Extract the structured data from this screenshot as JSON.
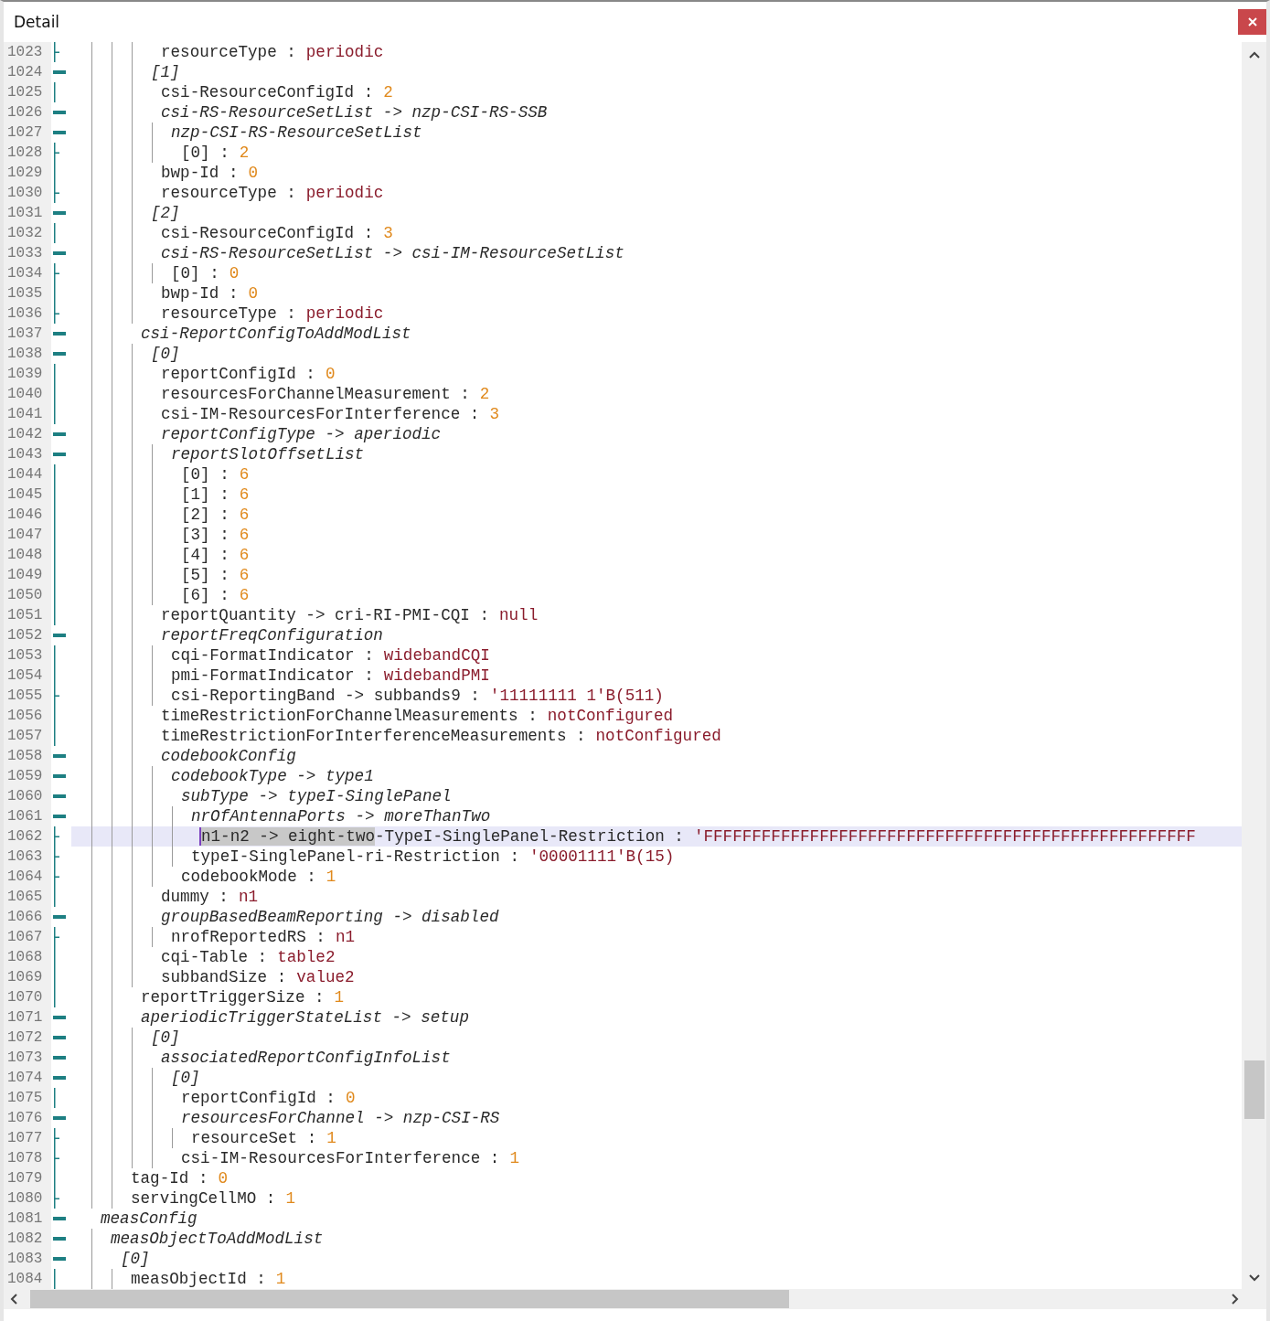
{
  "window": {
    "title": "Detail"
  },
  "editor": {
    "lines": [
      {
        "children": [
          {
            "children": [
              {
                "children": [
                  {
                    "children": [
                      {
                        "children": [
                          {
                            "children": [
                              {
                                "no": "1023",
                                "kind": "end",
                                "key": "resourceType :",
                                "value": {
                                  "text": "periodic",
                                  "kind": "text"
                                },
                                "selected": false
                              }
                            ]
                          },
                          {
                            "no": "1024",
                            "kind": "open",
                            "key": "[1]",
                            "selected": false,
                            "children": [
                              {
                                "no": "1025",
                                "kind": "mid",
                                "key": "csi-ResourceConfigId :",
                                "value": {
                                  "text": "2",
                                  "kind": "number"
                                },
                                "selected": false
                              },
                              {
                                "no": "1026",
                                "kind": "open",
                                "key": "csi-RS-ResourceSetList -> nzp-CSI-RS-SSB",
                                "selected": false,
                                "children": [
                                  {
                                    "no": "1027",
                                    "kind": "open",
                                    "key": "nzp-CSI-RS-ResourceSetList",
                                    "selected": false,
                                    "children": [
                                      {
                                        "no": "1028",
                                        "kind": "end",
                                        "key": "[0] :",
                                        "value": {
                                          "text": "2",
                                          "kind": "number"
                                        },
                                        "selected": false
                                      }
                                    ]
                                  }
                                ]
                              },
                              {
                                "no": "1029",
                                "kind": "mid",
                                "key": "bwp-Id :",
                                "value": {
                                  "text": "0",
                                  "kind": "number"
                                },
                                "selected": false
                              },
                              {
                                "no": "1030",
                                "kind": "end",
                                "key": "resourceType :",
                                "value": {
                                  "text": "periodic",
                                  "kind": "text"
                                },
                                "selected": false
                              }
                            ]
                          },
                          {
                            "no": "1031",
                            "kind": "open",
                            "key": "[2]",
                            "selected": false,
                            "children": [
                              {
                                "no": "1032",
                                "kind": "mid",
                                "key": "csi-ResourceConfigId :",
                                "value": {
                                  "text": "3",
                                  "kind": "number"
                                },
                                "selected": false
                              },
                              {
                                "no": "1033",
                                "kind": "open",
                                "key": "csi-RS-ResourceSetList -> csi-IM-ResourceSetList",
                                "selected": false,
                                "children": [
                                  {
                                    "no": "1034",
                                    "kind": "end",
                                    "key": "[0] :",
                                    "value": {
                                      "text": "0",
                                      "kind": "number"
                                    },
                                    "selected": false
                                  }
                                ]
                              },
                              {
                                "no": "1035",
                                "kind": "mid",
                                "key": "bwp-Id :",
                                "value": {
                                  "text": "0",
                                  "kind": "number"
                                },
                                "selected": false
                              },
                              {
                                "no": "1036",
                                "kind": "end",
                                "key": "resourceType :",
                                "value": {
                                  "text": "periodic",
                                  "kind": "text"
                                },
                                "selected": false
                              }
                            ]
                          }
                        ]
                      },
                      {
                        "no": "1037",
                        "kind": "open",
                        "key": "csi-ReportConfigToAddModList",
                        "selected": false,
                        "children": [
                          {
                            "no": "1038",
                            "kind": "open",
                            "key": "[0]",
                            "selected": false,
                            "children": [
                              {
                                "no": "1039",
                                "kind": "mid",
                                "key": "reportConfigId :",
                                "value": {
                                  "text": "0",
                                  "kind": "number"
                                },
                                "selected": false
                              },
                              {
                                "no": "1040",
                                "kind": "mid",
                                "key": "resourcesForChannelMeasurement :",
                                "value": {
                                  "text": "2",
                                  "kind": "number"
                                },
                                "selected": false
                              },
                              {
                                "no": "1041",
                                "kind": "mid",
                                "key": "csi-IM-ResourcesForInterference :",
                                "value": {
                                  "text": "3",
                                  "kind": "number"
                                },
                                "selected": false
                              },
                              {
                                "no": "1042",
                                "kind": "open",
                                "key": "reportConfigType -> aperiodic",
                                "selected": false,
                                "children": [
                                  {
                                    "no": "1043",
                                    "kind": "open",
                                    "key": "reportSlotOffsetList",
                                    "selected": false,
                                    "children": [
                                      {
                                        "no": "1044",
                                        "kind": "mid",
                                        "key": "[0] :",
                                        "value": {
                                          "text": "6",
                                          "kind": "number"
                                        },
                                        "selected": false
                                      },
                                      {
                                        "no": "1045",
                                        "kind": "mid",
                                        "key": "[1] :",
                                        "value": {
                                          "text": "6",
                                          "kind": "number"
                                        },
                                        "selected": false
                                      },
                                      {
                                        "no": "1046",
                                        "kind": "mid",
                                        "key": "[2] :",
                                        "value": {
                                          "text": "6",
                                          "kind": "number"
                                        },
                                        "selected": false
                                      },
                                      {
                                        "no": "1047",
                                        "kind": "mid",
                                        "key": "[3] :",
                                        "value": {
                                          "text": "6",
                                          "kind": "number"
                                        },
                                        "selected": false
                                      },
                                      {
                                        "no": "1048",
                                        "kind": "mid",
                                        "key": "[4] :",
                                        "value": {
                                          "text": "6",
                                          "kind": "number"
                                        },
                                        "selected": false
                                      },
                                      {
                                        "no": "1049",
                                        "kind": "mid",
                                        "key": "[5] :",
                                        "value": {
                                          "text": "6",
                                          "kind": "number"
                                        },
                                        "selected": false
                                      },
                                      {
                                        "no": "1050",
                                        "kind": "mid",
                                        "key": "[6] :",
                                        "value": {
                                          "text": "6",
                                          "kind": "number"
                                        },
                                        "selected": false
                                      }
                                    ]
                                  }
                                ]
                              },
                              {
                                "no": "1051",
                                "kind": "mid",
                                "key": "reportQuantity -> cri-RI-PMI-CQI :",
                                "value": {
                                  "text": "null",
                                  "kind": "text"
                                },
                                "selected": false
                              },
                              {
                                "no": "1052",
                                "kind": "open",
                                "key": "reportFreqConfiguration",
                                "selected": false,
                                "children": [
                                  {
                                    "no": "1053",
                                    "kind": "mid",
                                    "key": "cqi-FormatIndicator :",
                                    "value": {
                                      "text": "widebandCQI",
                                      "kind": "text"
                                    },
                                    "selected": false
                                  },
                                  {
                                    "no": "1054",
                                    "kind": "mid",
                                    "key": "pmi-FormatIndicator :",
                                    "value": {
                                      "text": "widebandPMI",
                                      "kind": "text"
                                    },
                                    "selected": false
                                  },
                                  {
                                    "no": "1055",
                                    "kind": "end",
                                    "key": "csi-ReportingBand -> subbands9 :",
                                    "value": {
                                      "text": "'11111111 1'B(511)",
                                      "kind": "text"
                                    },
                                    "selected": false
                                  }
                                ]
                              },
                              {
                                "no": "1056",
                                "kind": "mid",
                                "key": "timeRestrictionForChannelMeasurements :",
                                "value": {
                                  "text": "notConfigured",
                                  "kind": "text"
                                },
                                "selected": false
                              },
                              {
                                "no": "1057",
                                "kind": "mid",
                                "key": "timeRestrictionForInterferenceMeasurements :",
                                "value": {
                                  "text": "notConfigured",
                                  "kind": "text"
                                },
                                "selected": false
                              },
                              {
                                "no": "1058",
                                "kind": "open",
                                "key": "codebookConfig",
                                "selected": false,
                                "children": [
                                  {
                                    "no": "1059",
                                    "kind": "open",
                                    "key": "codebookType -> type1",
                                    "selected": false,
                                    "children": [
                                      {
                                        "no": "1060",
                                        "kind": "open",
                                        "key": "subType -> typeI-SinglePanel",
                                        "selected": false,
                                        "children": [
                                          {
                                            "no": "1061",
                                            "kind": "open",
                                            "key": "nrOfAntennaPorts -> moreThanTwo",
                                            "selected": false,
                                            "children": [
                                              {
                                                "no": "1062",
                                                "kind": "end",
                                                "selected_part": "n1-n2 -> eight-two",
                                                "key": "-TypeI-SinglePanel-Restriction :",
                                                "value": {
                                                  "text": "'FFFFFFFFFFFFFFFFFFFFFFFFFFFFFFFFFFFFFFFFFFFFFFFFFFF",
                                                  "kind": "text"
                                                },
                                                "selected": true
                                              }
                                            ]
                                          },
                                          {
                                            "no": "1063",
                                            "kind": "end",
                                            "key": "typeI-SinglePanel-ri-Restriction :",
                                            "value": {
                                              "text": "'00001111'B(15)",
                                              "kind": "text"
                                            },
                                            "selected": false
                                          }
                                        ]
                                      },
                                      {
                                        "no": "1064",
                                        "kind": "end",
                                        "key": "codebookMode :",
                                        "value": {
                                          "text": "1",
                                          "kind": "number"
                                        },
                                        "selected": false
                                      }
                                    ]
                                  }
                                ]
                              },
                              {
                                "no": "1065",
                                "kind": "mid",
                                "key": "dummy :",
                                "value": {
                                  "text": "n1",
                                  "kind": "text"
                                },
                                "selected": false
                              },
                              {
                                "no": "1066",
                                "kind": "open",
                                "key": "groupBasedBeamReporting -> disabled",
                                "selected": false,
                                "children": [
                                  {
                                    "no": "1067",
                                    "kind": "end",
                                    "key": "nrofReportedRS :",
                                    "value": {
                                      "text": "n1",
                                      "kind": "text"
                                    },
                                    "selected": false
                                  }
                                ]
                              },
                              {
                                "no": "1068",
                                "kind": "mid",
                                "key": "cqi-Table :",
                                "value": {
                                  "text": "table2",
                                  "kind": "text"
                                },
                                "selected": false
                              },
                              {
                                "no": "1069",
                                "kind": "mid",
                                "key": "subbandSize :",
                                "value": {
                                  "text": "value2",
                                  "kind": "text"
                                },
                                "selected": false
                              }
                            ]
                          }
                        ]
                      },
                      {
                        "no": "1070",
                        "kind": "mid",
                        "key": "reportTriggerSize :",
                        "value": {
                          "text": "1",
                          "kind": "number"
                        },
                        "selected": false
                      },
                      {
                        "no": "1071",
                        "kind": "open",
                        "key": "aperiodicTriggerStateList -> setup",
                        "selected": false,
                        "children": [
                          {
                            "no": "1072",
                            "kind": "open",
                            "key": "[0]",
                            "selected": false,
                            "children": [
                              {
                                "no": "1073",
                                "kind": "open",
                                "key": "associatedReportConfigInfoList",
                                "selected": false,
                                "children": [
                                  {
                                    "no": "1074",
                                    "kind": "open",
                                    "key": "[0]",
                                    "selected": false,
                                    "children": [
                                      {
                                        "no": "1075",
                                        "kind": "mid",
                                        "key": "reportConfigId :",
                                        "value": {
                                          "text": "0",
                                          "kind": "number"
                                        },
                                        "selected": false
                                      },
                                      {
                                        "no": "1076",
                                        "kind": "open",
                                        "key": "resourcesForChannel -> nzp-CSI-RS",
                                        "selected": false,
                                        "children": [
                                          {
                                            "no": "1077",
                                            "kind": "end",
                                            "key": "resourceSet :",
                                            "value": {
                                              "text": "1",
                                              "kind": "number"
                                            },
                                            "selected": false
                                          }
                                        ]
                                      },
                                      {
                                        "no": "1078",
                                        "kind": "end",
                                        "key": "csi-IM-ResourcesForInterference :",
                                        "value": {
                                          "text": "1",
                                          "kind": "number"
                                        },
                                        "selected": false
                                      }
                                    ]
                                  }
                                ]
                              }
                            ]
                          }
                        ]
                      }
                    ]
                  },
                  {
                    "no": "1079",
                    "kind": "mid",
                    "key": "tag-Id :",
                    "value": {
                      "text": "0",
                      "kind": "number"
                    },
                    "selected": false
                  },
                  {
                    "no": "1080",
                    "kind": "end",
                    "key": "servingCellMO :",
                    "value": {
                      "text": "1",
                      "kind": "number"
                    },
                    "selected": false
                  }
                ]
              }
            ]
          }
        ]
      },
      {
        "no": "1081",
        "kind": "open",
        "key": "measConfig",
        "selected": false,
        "children": [
          {
            "no": "1082",
            "kind": "open",
            "key": "measObjectToAddModList",
            "selected": false,
            "children": [
              {
                "no": "1083",
                "kind": "open",
                "key": "[0]",
                "selected": false,
                "children": [
                  {
                    "no": "1084",
                    "kind": "mid",
                    "key": "measObjectId :",
                    "value": {
                      "text": "1",
                      "kind": "number"
                    },
                    "selected": false
                  }
                ]
              }
            ]
          }
        ]
      }
    ]
  }
}
